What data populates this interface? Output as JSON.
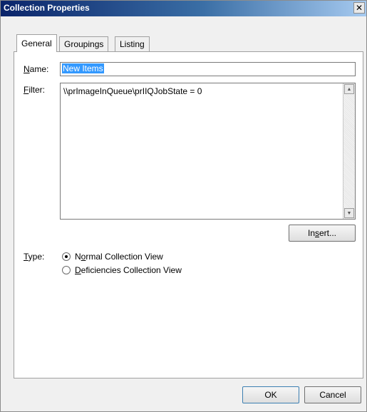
{
  "dialog": {
    "title": "Collection Properties",
    "close_glyph": "✕"
  },
  "tabs": [
    {
      "label": "General",
      "active": true
    },
    {
      "label": "Groupings",
      "active": false
    },
    {
      "label": "Listing",
      "active": false
    }
  ],
  "general": {
    "name_label": "Name:",
    "name_value": "New Items",
    "filter_label": "Filter:",
    "filter_value": "\\\\prImageInQueue\\prIIQJobState = 0",
    "insert_button": "Insert...",
    "type_label": "Type:",
    "type_options": [
      {
        "label": "Normal Collection View",
        "checked": true
      },
      {
        "label": "Deficiencies Collection View",
        "checked": false
      }
    ]
  },
  "footer": {
    "ok_label": "OK",
    "cancel_label": "Cancel"
  }
}
